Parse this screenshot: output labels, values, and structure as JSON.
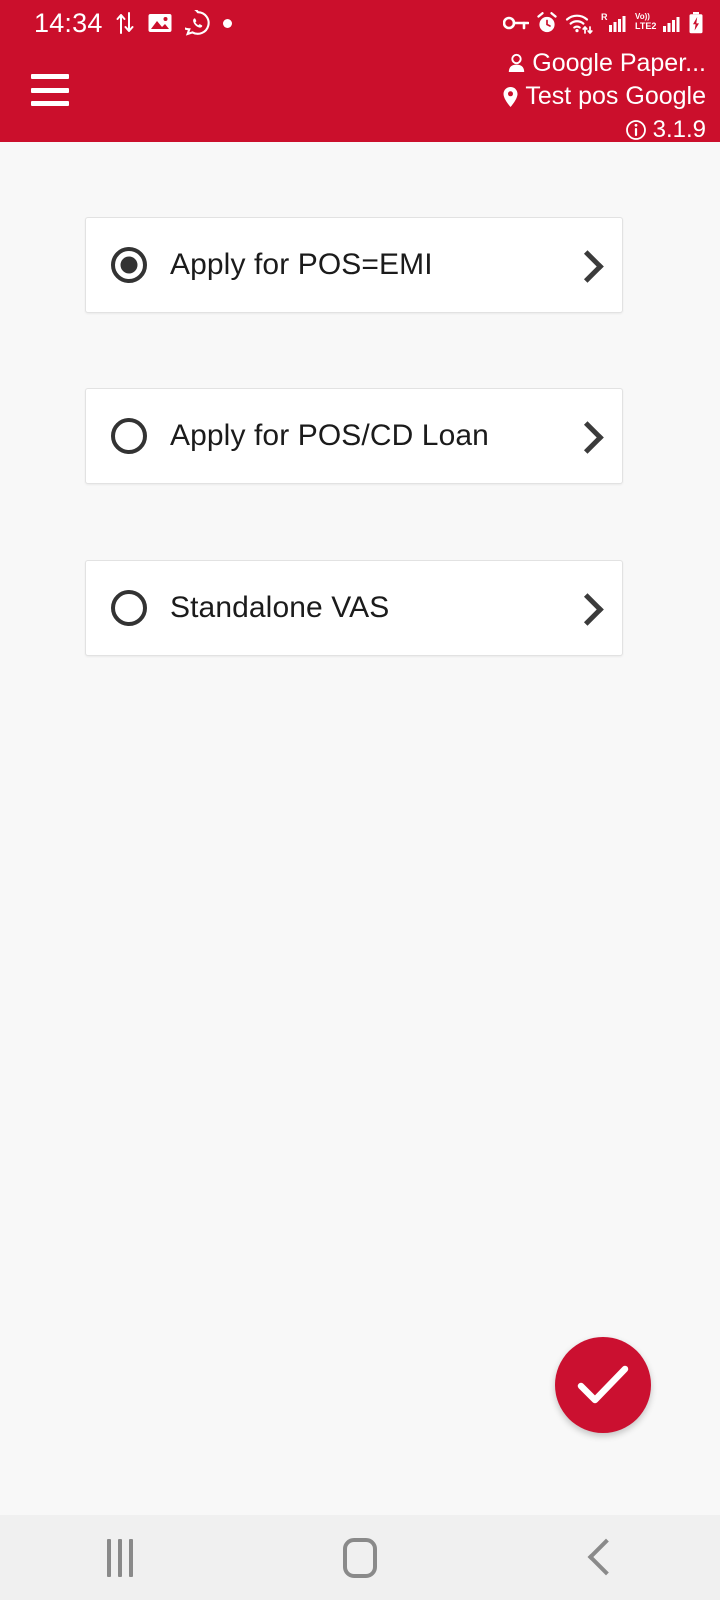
{
  "status_bar": {
    "time": "14:34",
    "left_icons": [
      "data-transfer-icon",
      "image-icon",
      "whatsapp-icon",
      "dot-icon"
    ],
    "right_icons": [
      "vpn-key-icon",
      "alarm-icon",
      "wifi-icon",
      "signal-roaming-icon",
      "volte-signal-icon",
      "battery-charging-icon"
    ],
    "roaming_label": "R",
    "volte_label": "Vo))",
    "network_label": "LTE2"
  },
  "header": {
    "menu_label": "menu",
    "user_name": "Google Paper...",
    "location_name": "Test pos Google",
    "app_version": "3.1.9",
    "background_color": "#CB0F2C"
  },
  "main": {
    "options": [
      {
        "label": "Apply for POS=EMI",
        "selected": true
      },
      {
        "label": "Apply for POS/CD Loan",
        "selected": false
      },
      {
        "label": "Standalone VAS",
        "selected": false
      }
    ]
  },
  "fab": {
    "label": "Confirm",
    "icon": "check-icon",
    "color": "#CB1030"
  },
  "nav_bar": {
    "recents_label": "Recents",
    "home_label": "Home",
    "back_label": "Back"
  }
}
